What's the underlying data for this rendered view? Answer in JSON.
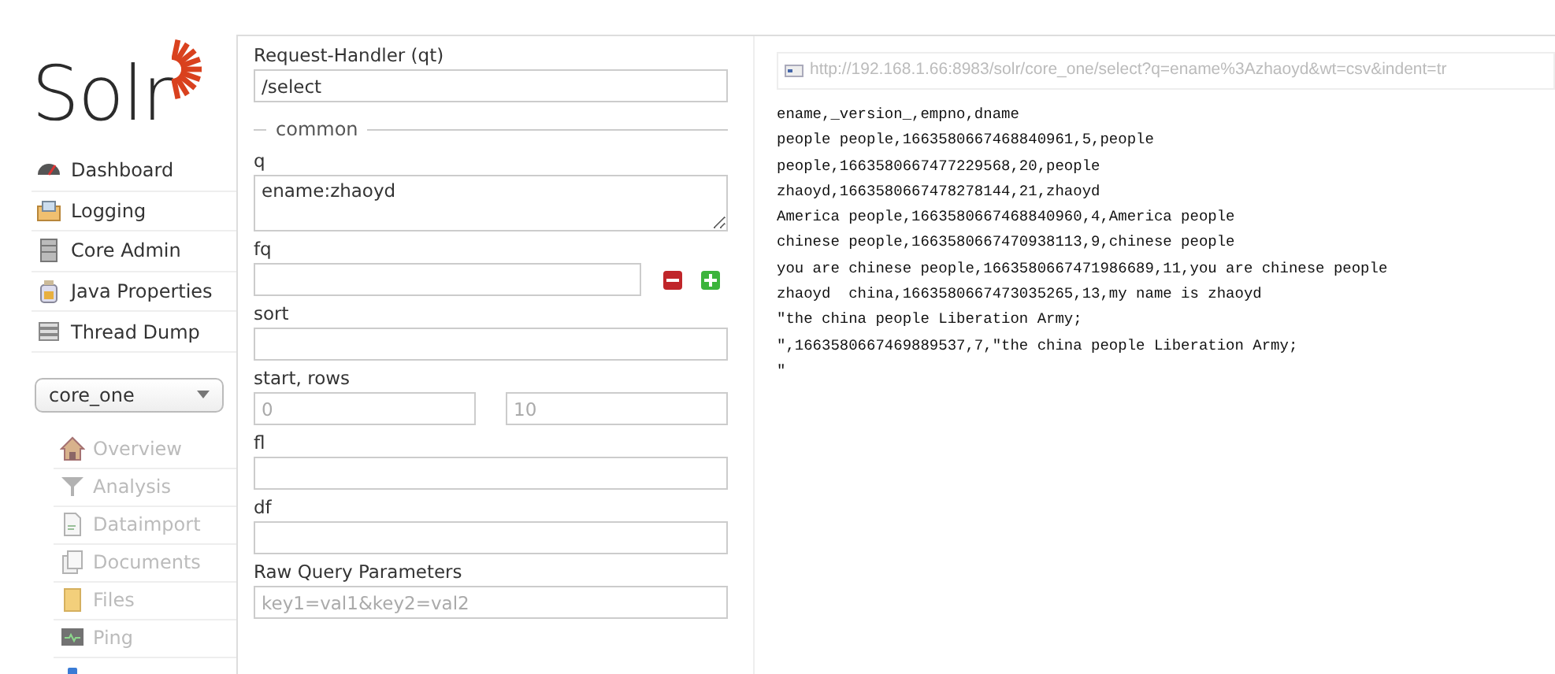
{
  "brand": {
    "name": "Solr"
  },
  "nav": [
    {
      "label": "Dashboard"
    },
    {
      "label": "Logging"
    },
    {
      "label": "Core Admin"
    },
    {
      "label": "Java Properties"
    },
    {
      "label": "Thread Dump"
    }
  ],
  "core_selector": {
    "value": "core_one"
  },
  "core_nav": [
    {
      "kind": "item",
      "label": "Overview",
      "disabled": true
    },
    {
      "kind": "item",
      "label": "Analysis",
      "disabled": true
    },
    {
      "kind": "item",
      "label": "Dataimport",
      "disabled": true
    },
    {
      "kind": "item",
      "label": "Documents",
      "disabled": true
    },
    {
      "kind": "item",
      "label": "Files",
      "disabled": true
    },
    {
      "kind": "item",
      "label": "Ping",
      "disabled": true
    },
    {
      "kind": "cut"
    }
  ],
  "query_form": [
    {
      "kind": "input",
      "label": "Request-Handler (qt)",
      "value": "/select"
    },
    {
      "kind": "legend",
      "label": "common"
    },
    {
      "kind": "textarea",
      "label": "q",
      "value": "ename:zhaoyd"
    },
    {
      "kind": "input_buttons",
      "label": "fq"
    },
    {
      "kind": "input",
      "label": "sort"
    },
    {
      "kind": "pair",
      "label": "start, rows",
      "placeholders": [
        "0",
        "10"
      ]
    },
    {
      "kind": "input",
      "label": "fl"
    },
    {
      "kind": "input",
      "label": "df"
    },
    {
      "kind": "input",
      "label": "Raw Query Parameters",
      "placeholder": "key1=val1&key2=val2"
    }
  ],
  "results": {
    "url": "http://192.168.1.66:8983/solr/core_one/select?q=ename%3Azhaoyd&wt=csv&indent=tr",
    "lines": [
      "ename,_version_,empno,dname",
      "people people,1663580667468840961,5,people",
      "people,1663580667477229568,20,people",
      "zhaoyd,1663580667478278144,21,zhaoyd",
      "America people,1663580667468840960,4,America people",
      "chinese people,1663580667470938113,9,chinese people",
      "you are chinese people,1663580667471986689,11,you are chinese people",
      "zhaoyd  china,1663580667473035265,13,my name is zhaoyd",
      "\"the china people Liberation Army;",
      "\",1663580667469889537,7,\"the china people Liberation Army;",
      "\""
    ]
  }
}
